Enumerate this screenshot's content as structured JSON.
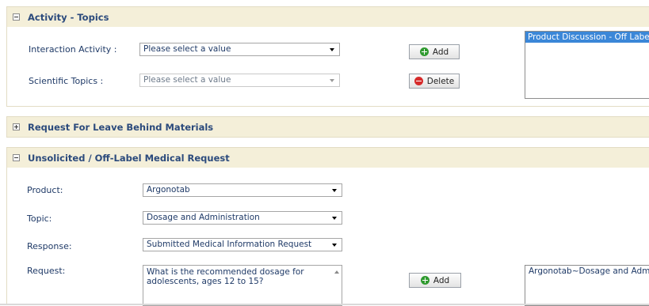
{
  "activity_topics": {
    "title": "Activity - Topics",
    "interaction_label": "Interaction Activity :",
    "interaction_value": "Please select a value",
    "scientific_label": "Scientific Topics :",
    "scientific_value": "Please select a value",
    "add_label": "Add",
    "delete_label": "Delete",
    "selected_list": [
      "Product Discussion - Off Label"
    ]
  },
  "leave_behind": {
    "title": "Request For Leave Behind Materials"
  },
  "unsolicited": {
    "title": "Unsolicited / Off-Label Medical Request",
    "product_label": "Product:",
    "product_value": "Argonotab",
    "topic_label": "Topic:",
    "topic_value": "Dosage and Administration",
    "response_label": "Response:",
    "response_value": "Submitted Medical Information Request",
    "request_label": "Request:",
    "request_value": "What is the recommended dosage for adolescents, ages 12 to 15?",
    "add_label": "Add",
    "selected_list": [
      "Argonotab~Dosage and Administration"
    ]
  }
}
